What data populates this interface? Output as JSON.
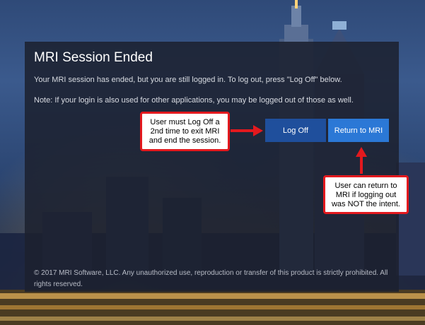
{
  "panel": {
    "title": "MRI Session Ended",
    "message": "Your MRI session has ended, but you are still logged in. To log out, press \"Log Off\" below.",
    "note": "Note: If your login is also used for other applications, you may be logged out of those as well.",
    "copyright": "© 2017 MRI Software, LLC. Any unauthorized use, reproduction or transfer of this product is strictly prohibited. All rights reserved."
  },
  "buttons": {
    "log_off": "Log Off",
    "return": "Return to MRI"
  },
  "annotations": {
    "log_off_callout": "User must Log Off a\n2nd time to exit MRI\nand end the session.",
    "return_callout": "User can return to\nMRI if logging out\nwas NOT the intent."
  },
  "colors": {
    "panel_bg": "#1c212e",
    "log_off_button": "#1f4f9c",
    "return_button": "#2b78d6",
    "callout_border": "#e3191e"
  }
}
